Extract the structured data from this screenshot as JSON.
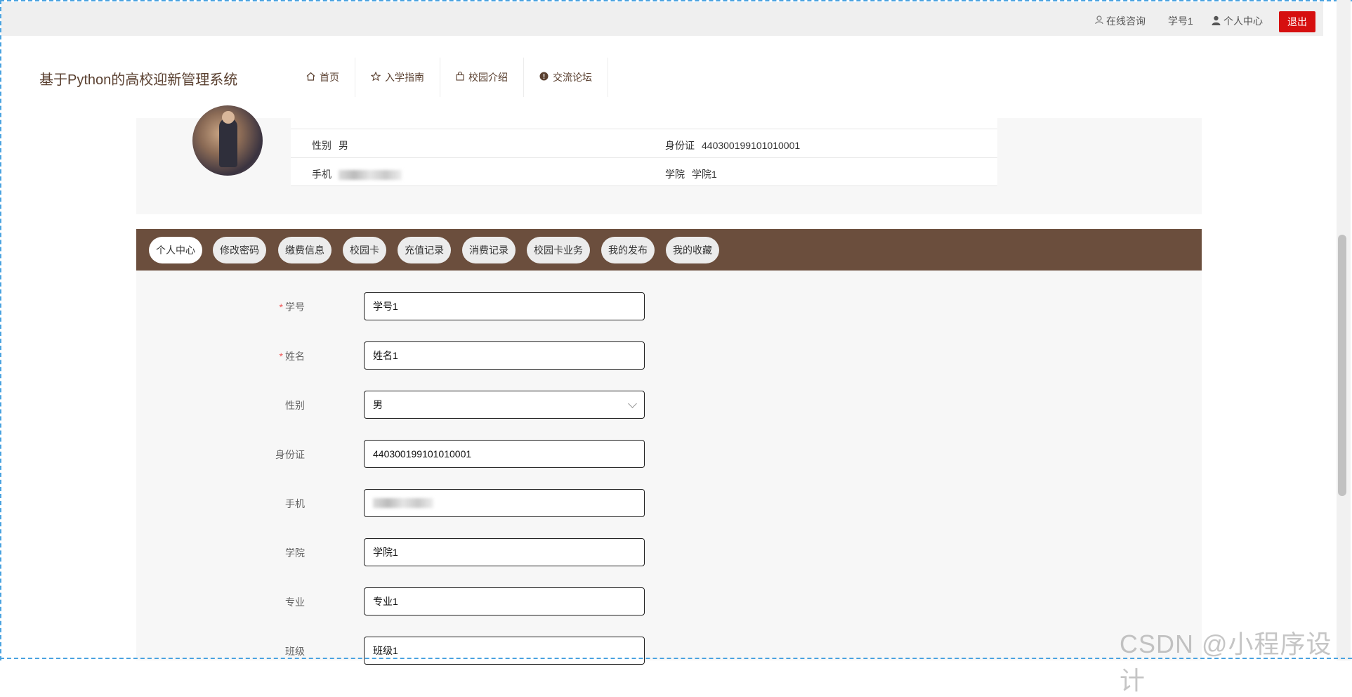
{
  "topbar": {
    "online_consult": "在线咨询",
    "username": "学号1",
    "personal_center": "个人中心",
    "logout": "退出"
  },
  "header": {
    "brand": "基于Python的高校迎新管理系统",
    "nav": [
      {
        "label": "首页",
        "icon": "home-icon"
      },
      {
        "label": "入学指南",
        "icon": "star-icon"
      },
      {
        "label": "校园介绍",
        "icon": "bag-icon"
      },
      {
        "label": "交流论坛",
        "icon": "info-icon"
      }
    ]
  },
  "summary": {
    "rows": [
      {
        "left_key": "性别",
        "left_val": "男",
        "right_key": "身份证",
        "right_val": "440300199101010001"
      },
      {
        "left_key": "手机",
        "left_val": "",
        "right_key": "学院",
        "right_val": "学院1"
      }
    ]
  },
  "tabs": [
    "个人中心",
    "修改密码",
    "缴费信息",
    "校园卡",
    "充值记录",
    "消费记录",
    "校园卡业务",
    "我的发布",
    "我的收藏"
  ],
  "active_tab": "个人中心",
  "form": {
    "fields": [
      {
        "label": "学号",
        "required": true,
        "value": "学号1"
      },
      {
        "label": "姓名",
        "required": true,
        "value": "姓名1"
      },
      {
        "label": "性别",
        "required": false,
        "value": "男",
        "select": true
      },
      {
        "label": "身份证",
        "required": false,
        "value": "440300199101010001"
      },
      {
        "label": "手机",
        "required": false,
        "value": ""
      },
      {
        "label": "学院",
        "required": false,
        "value": "学院1"
      },
      {
        "label": "专业",
        "required": false,
        "value": "专业1"
      },
      {
        "label": "班级",
        "required": false,
        "value": "班级1"
      }
    ]
  },
  "watermark": "CSDN @小程序设计",
  "colors": {
    "brown": "#6b4e3d",
    "logout_red": "#d60f0f",
    "brand_text": "#5a4030"
  }
}
